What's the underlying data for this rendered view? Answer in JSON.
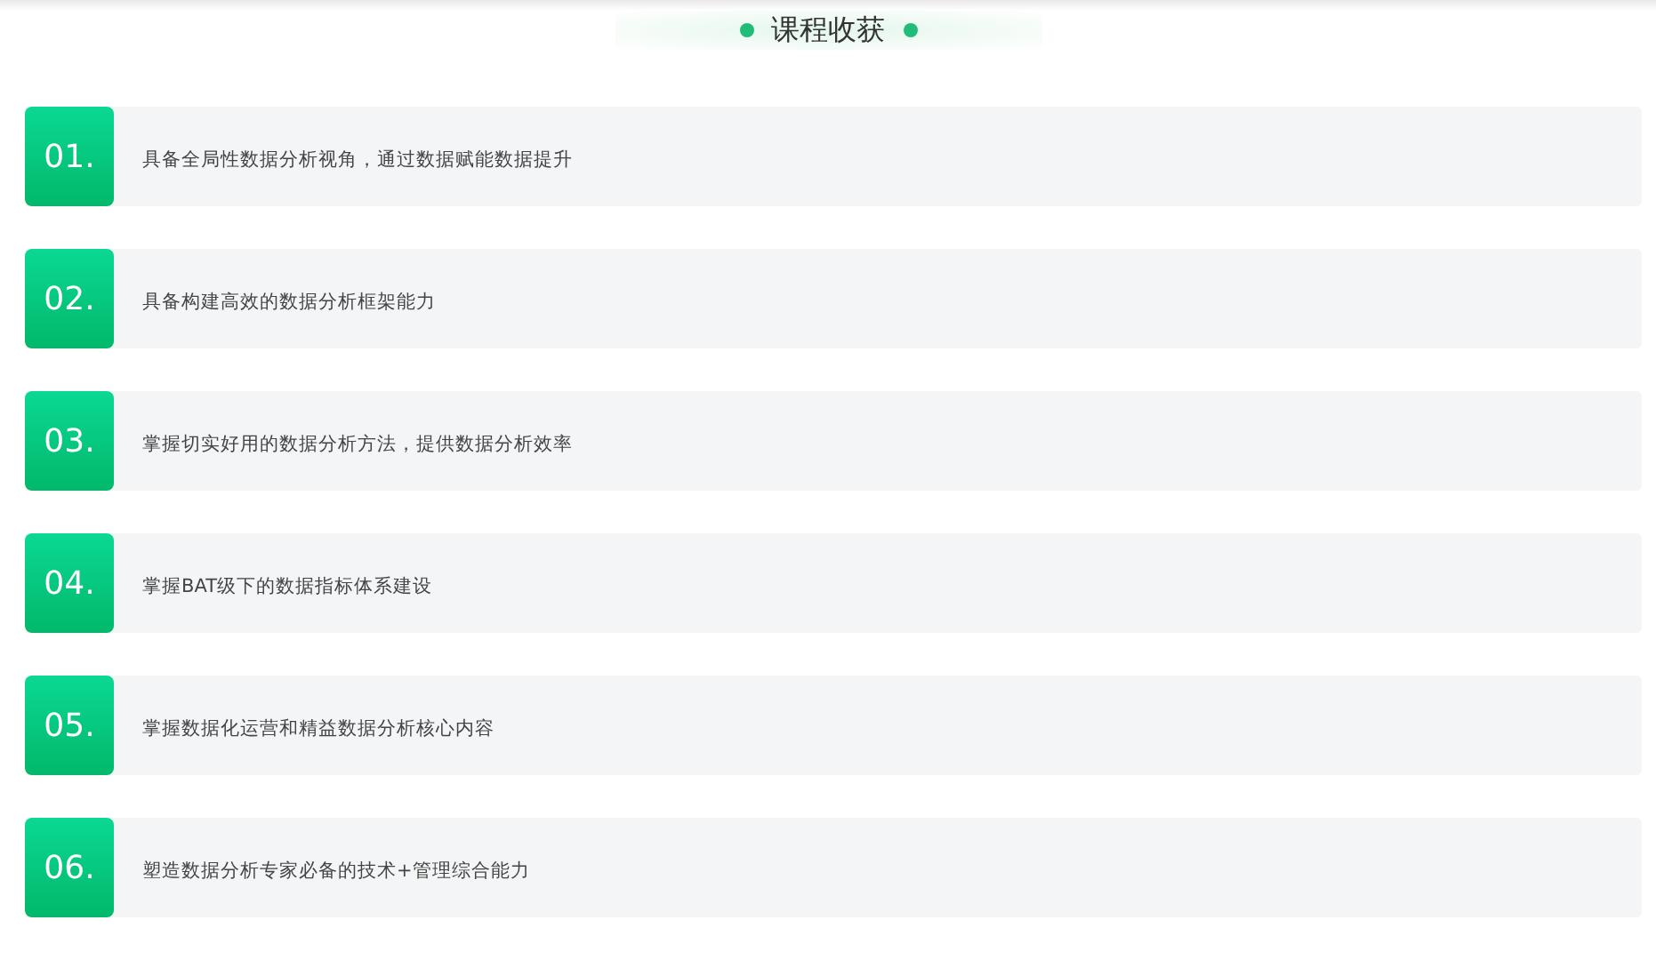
{
  "title": "课程收获",
  "items": [
    {
      "number": "01.",
      "text": "具备全局性数据分析视角，通过数据赋能数据提升"
    },
    {
      "number": "02.",
      "text": "具备构建高效的数据分析框架能力"
    },
    {
      "number": "03.",
      "text": "掌握切实好用的数据分析方法，提供数据分析效率"
    },
    {
      "number": "04.",
      "text": "掌握BAT级下的数据指标体系建设"
    },
    {
      "number": "05.",
      "text": "掌握数据化运营和精益数据分析核心内容"
    },
    {
      "number": "06.",
      "text": "塑造数据分析专家必备的技术+管理综合能力"
    }
  ]
}
